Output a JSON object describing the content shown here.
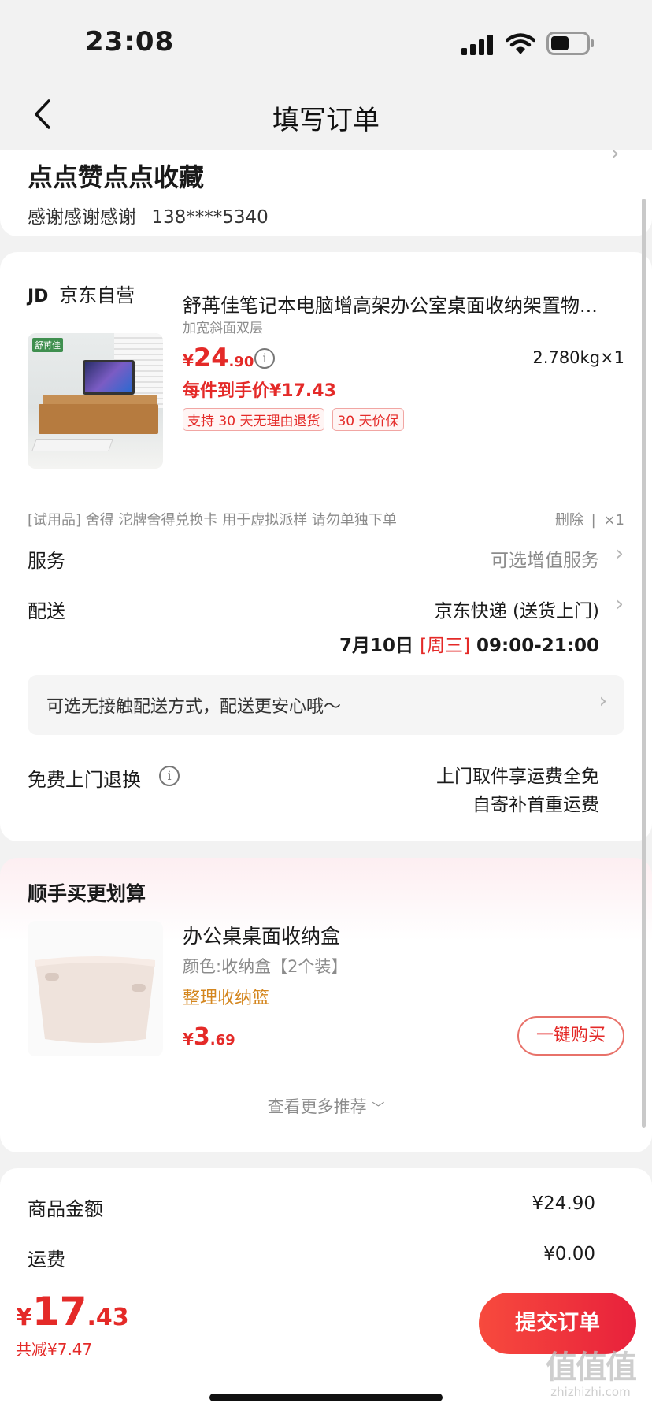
{
  "status": {
    "time": "23:08"
  },
  "nav": {
    "title": "填写订单"
  },
  "address": {
    "name": "点点赞点点收藏",
    "contact": "感谢感谢感谢",
    "phone": "138****5340"
  },
  "shop": {
    "logo": "JD",
    "name": "京东自营"
  },
  "product": {
    "image_brand": "舒苒佳",
    "title": "舒苒佳笔记本电脑增高架办公室桌面收纳架置物...",
    "spec": "加宽斜面双层",
    "price_symbol": "¥",
    "price_int": "24",
    "price_dec": ".90",
    "weight_qty": "2.780kg×1",
    "final_price": "每件到手价¥17.43",
    "tags": [
      "支持 30 天无理由退货",
      "30 天价保"
    ]
  },
  "trial": {
    "text": "[试用品] 舍得 沱牌舍得兑换卡 用于虚拟派样 请勿单独下单",
    "delete": "删除",
    "divider": "|",
    "qty": "×1"
  },
  "service": {
    "label": "服务",
    "value": "可选增值服务"
  },
  "delivery": {
    "label": "配送",
    "method": "京东快递 (送货上门)",
    "date": "7月10日",
    "weekday": "[周三]",
    "time": "09:00-21:00"
  },
  "contactless": {
    "text": "可选无接触配送方式，配送更安心哦～"
  },
  "returns": {
    "label": "免费上门退换",
    "line1": "上门取件享运费全免",
    "line2": "自寄补首重运费"
  },
  "recommend": {
    "title": "顺手买更划算",
    "item_title": "办公桌桌面收纳盒",
    "item_spec": "颜色:收纳盒【2个装】",
    "item_category": "整理收纳篮",
    "price_symbol": "¥",
    "price_int": "3",
    "price_dec": ".69",
    "buy_label": "一键购买",
    "more": "查看更多推荐"
  },
  "summary": {
    "goods_label": "商品金额",
    "goods_value": "¥24.90",
    "shipping_label": "运费",
    "shipping_value": "¥0.00"
  },
  "footer": {
    "price_symbol": "¥",
    "price_int": "17",
    "price_dec": ".43",
    "saved": "共减¥7.47",
    "submit": "提交订单"
  },
  "watermark": {
    "text": "值值值",
    "url": "zhizhizhi.com"
  }
}
